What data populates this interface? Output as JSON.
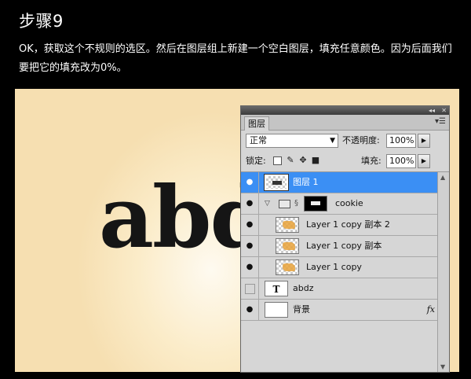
{
  "tutorial": {
    "step_title": "步骤9",
    "description": "OK，获取这个不规则的选区。然后在图层组上新建一个空白图层，填充任意颜色。因为后面我们要把它的填充改为0%。"
  },
  "canvas": {
    "text": "abd"
  },
  "panel": {
    "tab_label": "图层",
    "collapse_glyph": "◂◂",
    "close_glyph": "✕",
    "menu_glyph": "▾☰",
    "blend_mode": "正常",
    "opacity_label": "不透明度:",
    "opacity_value": "100%",
    "lock_label": "锁定:",
    "fill_label": "填充:",
    "fill_value": "100%",
    "layers": [
      {
        "name": "图层 1",
        "selected": true,
        "visible": true
      },
      {
        "name": "cookie",
        "type": "group",
        "visible": true
      },
      {
        "name": "Layer 1 copy 副本 2",
        "visible": true
      },
      {
        "name": "Layer 1 copy 副本",
        "visible": true
      },
      {
        "name": "Layer 1 copy",
        "visible": true
      },
      {
        "name": "abdz",
        "type": "text",
        "visible": false,
        "thumb_glyph": "T"
      },
      {
        "name": "背景",
        "visible": true,
        "fx": "fx"
      }
    ]
  },
  "colors": {
    "selection": "#3b8ff4",
    "canvas_bg": "#fbecc9"
  },
  "icons": {
    "eye": "eye-icon",
    "lock_transparent": "lock-transparent-icon",
    "lock_paint": "brush-icon",
    "lock_move": "move-icon",
    "lock_all": "lock-icon"
  }
}
